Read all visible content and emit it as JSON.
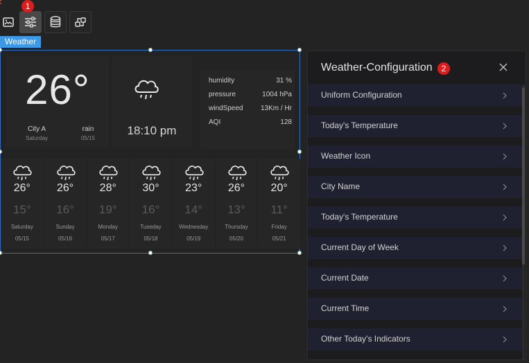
{
  "toolbar": {
    "buttons": [
      {
        "icon": "image-icon"
      },
      {
        "icon": "sliders-icon",
        "active": true,
        "badge": "1"
      },
      {
        "icon": "database-icon"
      },
      {
        "icon": "interaction-icon"
      }
    ]
  },
  "component_tag": "Weather",
  "weather": {
    "current": {
      "temperature": "26°",
      "city": "City A",
      "weekday": "Saturday",
      "condition": "rain",
      "date": "05/15",
      "time": "18:10 pm",
      "icon": "rain-cloud-icon"
    },
    "indicators": [
      {
        "label": "humidity",
        "value": "31 %"
      },
      {
        "label": "pressure",
        "value": "1004 hPa"
      },
      {
        "label": "windSpeed",
        "value": "13Km / Hr"
      },
      {
        "label": "AQI",
        "value": "128"
      }
    ],
    "forecast": [
      {
        "high": "26°",
        "low": "15°",
        "weekday": "Saturday",
        "date": "05/15"
      },
      {
        "high": "26°",
        "low": "16°",
        "weekday": "Sunday",
        "date": "05/16"
      },
      {
        "high": "28°",
        "low": "19°",
        "weekday": "Monday",
        "date": "05/17"
      },
      {
        "high": "30°",
        "low": "16°",
        "weekday": "Tuseday",
        "date": "05/18"
      },
      {
        "high": "23°",
        "low": "14°",
        "weekday": "Wednesday",
        "date": "05/19"
      },
      {
        "high": "26°",
        "low": "13°",
        "weekday": "Thursday",
        "date": "05/20"
      },
      {
        "high": "20°",
        "low": "11°",
        "weekday": "Friday",
        "date": "05/21"
      }
    ]
  },
  "config_panel": {
    "title": "Weather-Configuration",
    "badge": "2",
    "items": [
      {
        "label": "Uniform Configuration"
      },
      {
        "label": "Today's Temperature"
      },
      {
        "label": "Weather Icon"
      },
      {
        "label": "City Name"
      },
      {
        "label": "Today's Temperature"
      },
      {
        "label": "Current Day of Week"
      },
      {
        "label": "Current Date"
      },
      {
        "label": "Current Time"
      },
      {
        "label": "Other Today's Indicators"
      }
    ]
  },
  "colors": {
    "accent": "#3d99e6",
    "badge": "#e01b1b",
    "selection_border": "#2f6ec1"
  }
}
